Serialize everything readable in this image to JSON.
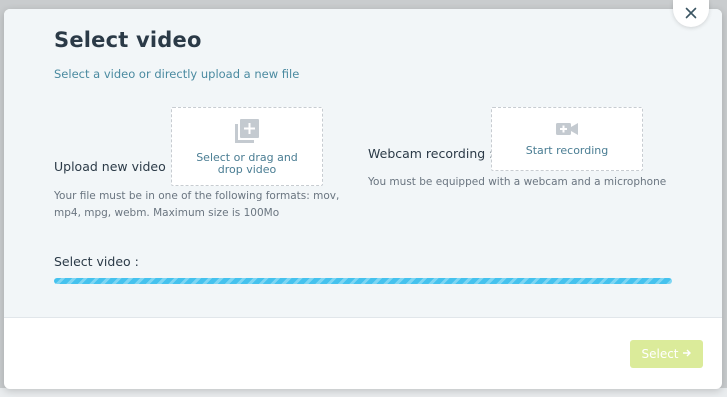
{
  "modal": {
    "title": "Select video",
    "subtitle": "Select a video or directly upload a new file"
  },
  "upload": {
    "label": "Upload new video :",
    "drop_text": "Select or drag and drop video",
    "help": "Your file must be in one of the following formats: mov, mp4, mpg, webm. Maximum size is 100Mo",
    "icon": "add-to-library-icon"
  },
  "webcam": {
    "label": "Webcam recording :",
    "button_text": "Start recording",
    "help": "You must be equipped with a webcam and a microphone",
    "icon": "video-camera-icon"
  },
  "select_video": {
    "label": "Select video :",
    "loading_progress": 1.0
  },
  "footer": {
    "select_label": "Select"
  },
  "colors": {
    "accent": "#45c2ee",
    "select_button": "#dbeb9a",
    "title": "#2b3a47",
    "subtitle": "#4a8aa0"
  }
}
